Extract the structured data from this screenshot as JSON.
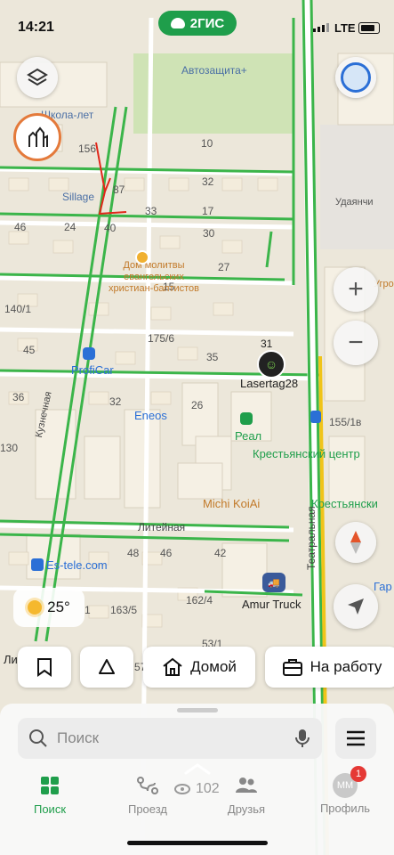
{
  "status": {
    "time": "14:21",
    "network": "LTE"
  },
  "app": {
    "logo_text": "2ГИС"
  },
  "map_labels": {
    "autoshop": "Автозащита+",
    "school": "Школа-лет",
    "sillage": "Sillage",
    "udaryanchi": "Удаянчи",
    "church": [
      "Дом молитвы",
      "евангельских",
      "христиан-баптистов"
    ],
    "proficar": "ProfiCar",
    "eneos": "Eneos",
    "lasertag": "Lasertag28",
    "real": "Реал",
    "krest_center": "Крестьянский центр",
    "krest": "Крестьянски",
    "michi": "Michi KoiAi",
    "liteynaya": "Литейная",
    "teatralnaya": "Театральная",
    "kuznechnaya": "Кузнечная",
    "estele": "Es-tele.com",
    "amur": "Amur Truck",
    "ugrob": "Угро",
    "gar_b": "Гар В",
    "li": "Ли"
  },
  "house_numbers": [
    "156",
    "10",
    "87",
    "32",
    "33",
    "17",
    "40",
    "30",
    "46",
    "24",
    "27",
    "15",
    "140/1",
    "175/6",
    "45",
    "35",
    "31",
    "36",
    "32",
    "26",
    "155/1в",
    "130",
    "48",
    "46",
    "42",
    "162/4",
    "163/5",
    "53/1",
    "57",
    "1"
  ],
  "weather": {
    "temp": "25°"
  },
  "chips": {
    "home": "Домой",
    "work": "На работу"
  },
  "search": {
    "placeholder": "Поиск"
  },
  "viewer_count": "102",
  "tabs": [
    {
      "label": "Поиск",
      "icon": "grid-icon"
    },
    {
      "label": "Проезд",
      "icon": "route-icon"
    },
    {
      "label": "Друзья",
      "icon": "friends-icon"
    },
    {
      "label": "Профиль",
      "icon": "profile-icon"
    }
  ],
  "profile": {
    "initials": "MM",
    "badge": "1"
  },
  "colors": {
    "accent": "#1f9e4b",
    "road_green": "#3bb54a",
    "road_yellow": "#f0c419",
    "poi_orange": "#c27a2a",
    "poi_blue": "#2b6fd6"
  }
}
